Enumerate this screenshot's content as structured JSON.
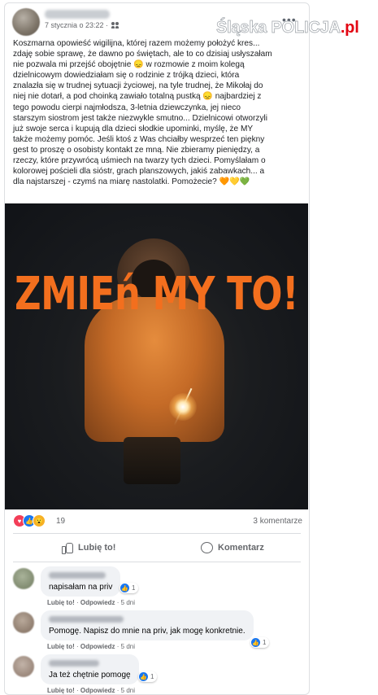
{
  "post": {
    "timestamp": "7 stycznia o 23:22 ·",
    "more_icon": "more-icon",
    "text": "Koszmarna opowieść wigilijna, której razem możemy położyć kres... \nzdaję sobie sprawę, że dawno po świętach, ale to co dzisiaj usłyszałam \nnie pozwala mi przejść obojętnie 😞 w rozmowie z moim kolegą \ndzielnicowym dowiedziałam się o rodzinie z trójką dzieci, która \nznalazła się w trudnej sytuacji życiowej, na tyle trudnej, że Mikołaj do \nniej nie dotarł, a pod choinką zawiało totalną pustką 😞 najbardziej z \ntego powodu cierpi najmłodsza, 3-letnia dziewczynka, jej nieco \nstarszym siostrom jest także niezwykle smutno... Dzielnicowi otworzyli \njuż swoje serca i kupują dla dzieci słodkie upominki, myślę, że MY \ntakże możemy pomóc. Jeśli ktoś z Was chciałby wesprzeć ten piękny \ngest to proszę o osobisty kontakt ze mną. Nie zbieramy pieniędzy, a \nrzeczy, które przywrócą uśmiech na twarzy tych dzieci. Pomyślałam o \nkolorowej pościeli dla sióstr, grach planszowych, jakiś zabawkach... a \ndla najstarszej - czymś na miarę nastolatki. Pomożecie? 🧡💛💚",
    "image_slogan": "ZMIEń MY TO!",
    "reaction_count": "19",
    "comments_count": "3 komentarze",
    "like_label": "Lubię to!",
    "comment_label": "Komentarz"
  },
  "comments": [
    {
      "text": "napisałam na priv",
      "likes": "1",
      "like_label": "Lubię to!",
      "reply_label": "Odpowiedz",
      "age": "5 dni"
    },
    {
      "text": "Pomogę. Napisz do mnie na priv, jak mogę konkretnie.",
      "likes": "1",
      "like_label": "Lubię to!",
      "reply_label": "Odpowiedz",
      "age": "5 dni"
    },
    {
      "text": "Ja też chętnie pomogę",
      "likes": "1",
      "like_label": "Lubię to!",
      "reply_label": "Odpowiedz",
      "age": "5 dni"
    }
  ],
  "watermark": {
    "main": "Śląska POLICJA",
    "suffix": ".pl"
  },
  "colors": {
    "slogan": "#f36f1e",
    "like_blue": "#1877f2",
    "love_red": "#f33e58",
    "wow_yellow": "#f7b125"
  }
}
